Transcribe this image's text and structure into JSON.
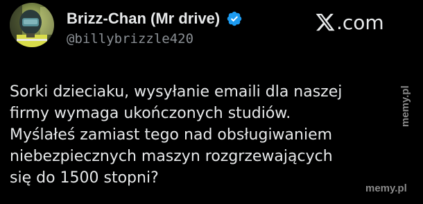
{
  "header": {
    "display_name": "Brizz-Chan (Mr drive)",
    "handle": "@billybrizzle420",
    "brand_text": ".com",
    "verified_icon": "verified-badge-icon",
    "brand_icon": "x-logo-icon"
  },
  "tweet": {
    "lines": [
      "Sorki dzieciaku, wysyłanie emaili dla naszej",
      "firmy wymaga ukończonych studiów.",
      "Myślałeś zamiast tego nad obsługiwaniem",
      "niebezpiecznych maszyn rozgrzewających",
      "się do 1500 stopni?"
    ]
  },
  "watermarks": {
    "side": "memy.pl",
    "bottom": "memy.pl"
  },
  "colors": {
    "background": "#000000",
    "text": "#e7e9ea",
    "secondary_text": "#8b9095",
    "verified": "#1d9bf0",
    "watermark": "#8a8a8a"
  }
}
